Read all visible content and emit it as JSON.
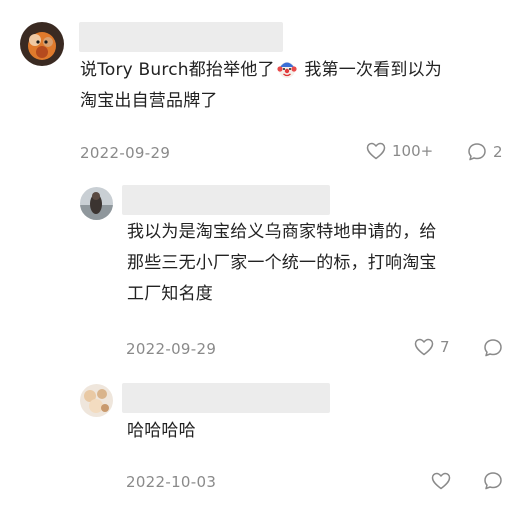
{
  "comments": [
    {
      "text_part1": "说Tory Burch都抬举他了",
      "text_part2": " 我第一次看到以为",
      "text_line2": "淘宝出自营品牌了",
      "emoji_name": "clown-face-emoji",
      "date": "2022-09-29",
      "likes": "100+",
      "replies": "2"
    },
    {
      "line1": "我以为是淘宝给义乌商家特地申请的，给",
      "line2": "那些三无小厂家一个统一的标，打响淘宝",
      "line3": "工厂知名度",
      "date": "2022-09-29",
      "likes": "7"
    },
    {
      "line1": "哈哈哈哈",
      "date": "2022-10-03"
    }
  ]
}
